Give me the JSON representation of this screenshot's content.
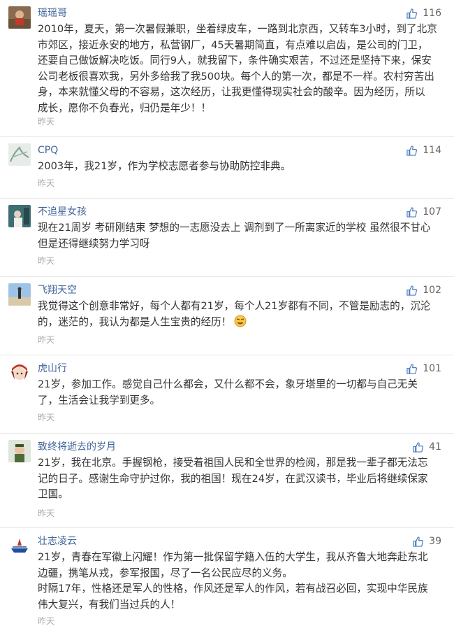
{
  "comments": [
    {
      "user": "瑶瑶哥",
      "likes": "116",
      "time": "昨天",
      "lines": [
        "2010年，夏天，第一次暑假兼职，坐着绿皮车，一路到北京西，又转车3小时，到了北京",
        "市郊区，接近永安的地方，私营钢厂，45天暑期简直，有点难以启齿，是公司的门卫，",
        "还要自己做饭解决吃饭。同行9人，就我留下，条件确实艰苦，不过还是坚持下来，保安",
        "公司老板很喜欢我，另外多给我了我500块。每个人的第一次，都是不一样。农村穷苦出",
        "身，本来就懂父母的不容易，这次经历，让我更懂得现实社会的酸辛。因为经历，所以",
        "成长，愿你不负春光，归仍是年少！！"
      ]
    },
    {
      "user": "CPQ",
      "likes": "114",
      "time": "昨天",
      "lines": [
        "2003年，我21岁，作为学校志愿者参与协助防控非典。"
      ]
    },
    {
      "user": "不追星女孩",
      "likes": "107",
      "time": "昨天",
      "lines": [
        "现在21周岁 考研刚结束 梦想的一志愿没去上 调剂到了一所离家近的学校 虽然很不甘心",
        "但是还得继续努力学习呀"
      ]
    },
    {
      "user": "飞翔天空",
      "likes": "102",
      "time": "昨天",
      "lines": [
        "我觉得这个创意非常好，每个人都有21岁，每个人21岁都有不同，不管是励志的，沉沦",
        "的，迷茫的，我认为都是人生宝贵的经历！"
      ],
      "emoji": "smile-emoji"
    },
    {
      "user": "虎山行",
      "likes": "101",
      "time": "昨天",
      "lines": [
        "21岁，参加工作。感觉自己什么都会，又什么都不会，象牙塔里的一切都与自己无关",
        "了，生活会让我学到更多。"
      ]
    },
    {
      "user": "致终将逝去的岁月",
      "likes": "41",
      "time": "昨天",
      "lines": [
        "21岁，我在北京。手握钢枪，接受着祖国人民和全世界的检阅，那是我一辈子都无法忘",
        "记的日子。感谢生命守护过你，我的祖国！现在24岁，在武汉读书，毕业后将继续保家",
        "卫国。"
      ]
    },
    {
      "user": "壮志凌云",
      "likes": "39",
      "time": "昨天",
      "lines": [
        "21岁，青春在军徽上闪耀！作为第一批保留学籍入伍的大学生，我从齐鲁大地奔赴东北",
        "边疆，携笔从戎，参军报国，尽了一名公民应尽的义务。",
        "时隔17年，性格还是军人的性格，作风还是军人的作风，若有战召必回，实现中华民族",
        "伟大复兴，有我们当过兵的人！"
      ]
    }
  ]
}
